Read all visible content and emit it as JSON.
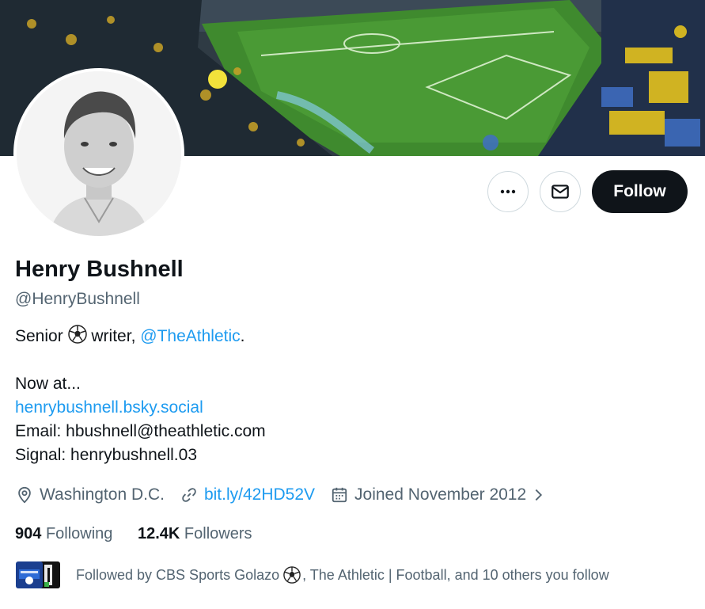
{
  "profile": {
    "name": "Henry Bushnell",
    "handle": "@HenryBushnell",
    "bio": {
      "line1_prefix": "Senior",
      "line1_middle": "writer,",
      "mention": "@TheAthletic",
      "line1_suffix": ".",
      "now_at": "Now at...",
      "site_link": "henrybushnell.bsky.social",
      "email": "Email: hbushnell@theathletic.com",
      "signal": "Signal: henrybushnell.03"
    },
    "location": "Washington D.C.",
    "website": "bit.ly/42HD52V",
    "joined": "Joined November 2012"
  },
  "stats": {
    "following_count": "904",
    "following_label": "Following",
    "followers_count": "12.4K",
    "followers_label": "Followers"
  },
  "followed_by": {
    "prefix": "Followed by CBS Sports Golazo",
    "suffix": ", The Athletic | Football, and 10 others you follow"
  },
  "actions": {
    "follow_label": "Follow"
  },
  "colors": {
    "accent": "#1d9bf0",
    "primary_button": "#0f1419",
    "secondary_text": "#536471",
    "border": "#cfd9de"
  },
  "icons": [
    "more-icon",
    "mail-icon",
    "location-icon",
    "link-icon",
    "calendar-icon",
    "chevron-right-icon",
    "soccer-ball-icon"
  ]
}
